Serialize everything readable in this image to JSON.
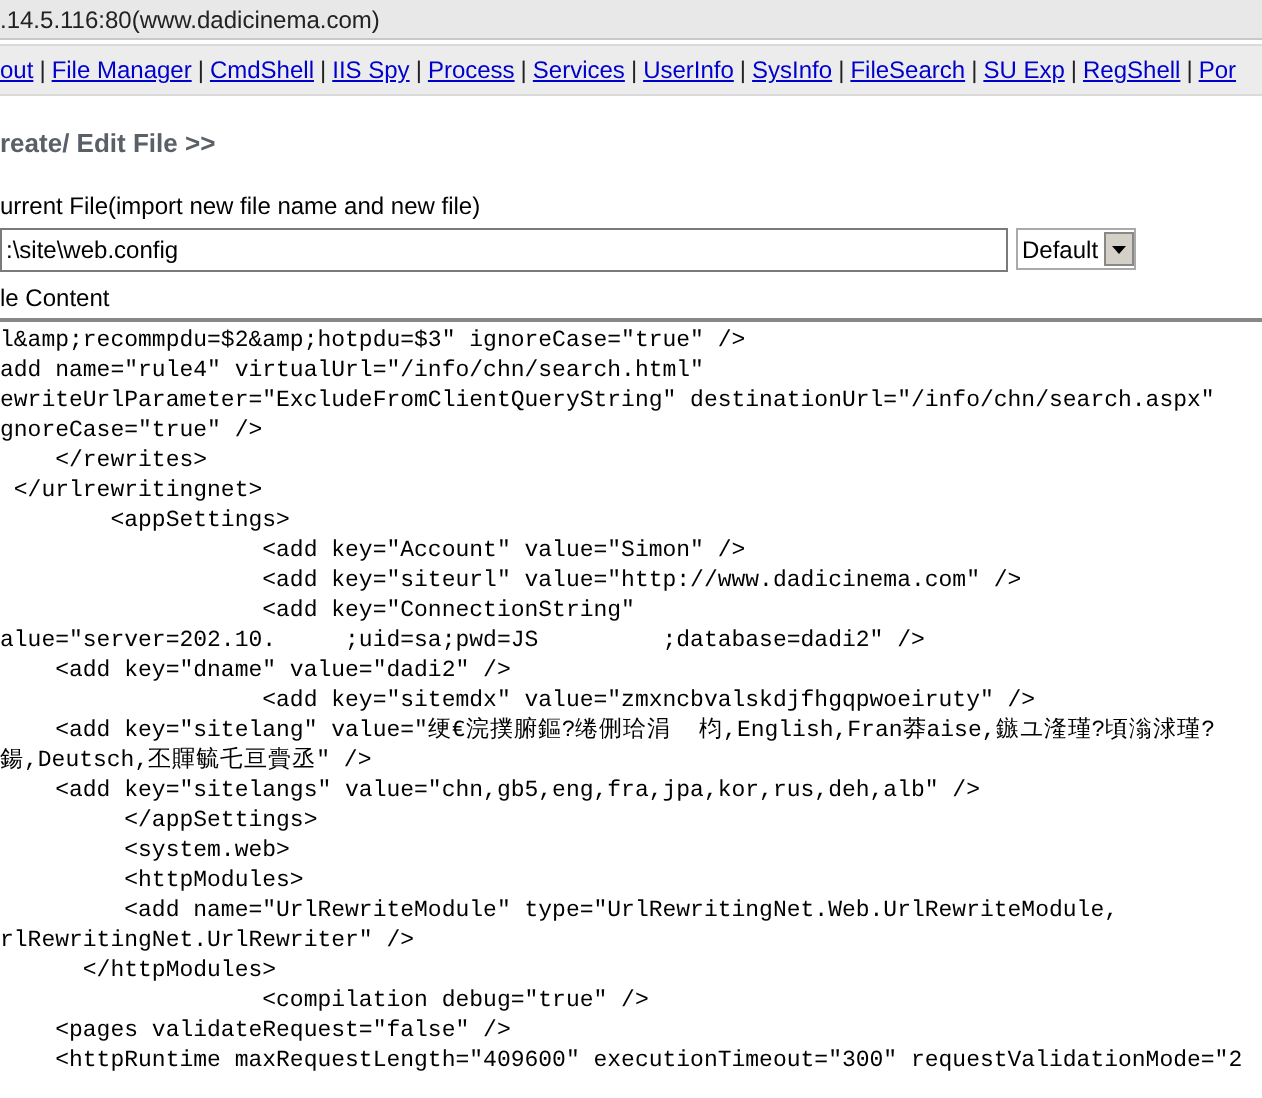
{
  "address_bar": {
    "text": ".14.5.116:80(www.dadicinema.com)"
  },
  "nav_items": [
    {
      "kind": "link",
      "label": "out"
    },
    {
      "kind": "separator",
      "label": "|"
    },
    {
      "kind": "link",
      "label": "File Manager"
    },
    {
      "kind": "separator",
      "label": "|"
    },
    {
      "kind": "link",
      "label": "CmdShell"
    },
    {
      "kind": "separator",
      "label": "|"
    },
    {
      "kind": "link",
      "label": "IIS Spy"
    },
    {
      "kind": "separator",
      "label": "|"
    },
    {
      "kind": "link",
      "label": "Process"
    },
    {
      "kind": "separator",
      "label": "|"
    },
    {
      "kind": "link",
      "label": "Services"
    },
    {
      "kind": "separator",
      "label": "|"
    },
    {
      "kind": "link",
      "label": "UserInfo"
    },
    {
      "kind": "separator",
      "label": "|"
    },
    {
      "kind": "link",
      "label": "SysInfo"
    },
    {
      "kind": "separator",
      "label": "|"
    },
    {
      "kind": "link",
      "label": "FileSearch"
    },
    {
      "kind": "separator",
      "label": "|"
    },
    {
      "kind": "link",
      "label": "SU Exp"
    },
    {
      "kind": "separator",
      "label": "|"
    },
    {
      "kind": "link",
      "label": "RegShell"
    },
    {
      "kind": "separator",
      "label": "|"
    },
    {
      "kind": "link",
      "label": "Por"
    }
  ],
  "heading": "reate/ Edit File >>",
  "current_file": {
    "label": "urrent File(import new file name and new file)",
    "value": ":\\site\\web.config",
    "encoding": "Default"
  },
  "content": {
    "label": "le Content",
    "lines": [
      "l&amp;recommpdu=$2&amp;hotpdu=$3\" ignoreCase=\"true\" />",
      "add name=\"rule4\" virtualUrl=\"/info/chn/search.html\"",
      "ewriteUrlParameter=\"ExcludeFromClientQueryString\" destinationUrl=\"/info/chn/search.aspx\"",
      "gnoreCase=\"true\" />",
      "    </rewrites>",
      " </urlrewritingnet>",
      "        <appSettings>",
      "                   <add key=\"Account\" value=\"Simon\" />",
      "                   <add key=\"siteurl\" value=\"http://www.dadicinema.com\" />",
      "                   <add key=\"ConnectionString\"",
      "alue=\"server=202.10.     ;uid=sa;pwd=JS         ;database=dadi2\" />",
      "    <add key=\"dname\" value=\"dadi2\" />",
      "                   <add key=\"sitemdx\" value=\"zmxncbvalskdjfhgqpwoeiruty\" />",
      "    <add key=\"sitelang\" value=\"绠€浣撲腑鏂?绻侀珨涓  枃,English,Fran莽aise,鏃ユ湰瑾?頃滃浗瑾?",
      "鍚,Deutsch,丕賱毓乇亘賷丞\" />",
      "    <add key=\"sitelangs\" value=\"chn,gb5,eng,fra,jpa,kor,rus,deh,alb\" />",
      "         </appSettings>",
      "         <system.web>",
      "         <httpModules>",
      "         <add name=\"UrlRewriteModule\" type=\"UrlRewritingNet.Web.UrlRewriteModule,",
      "rlRewritingNet.UrlRewriter\" />",
      "      </httpModules>",
      "                   <compilation debug=\"true\" />",
      "    <pages validateRequest=\"false\" />",
      "    <httpRuntime maxRequestLength=\"409600\" executionTimeout=\"300\" requestValidationMode=\"2"
    ]
  }
}
